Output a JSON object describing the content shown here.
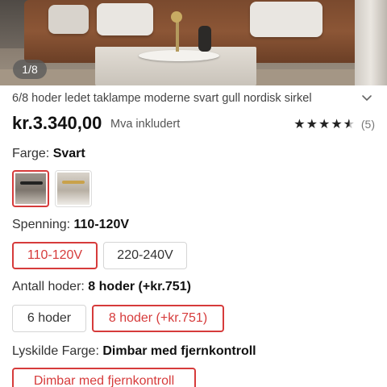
{
  "gallery": {
    "counter": "1/8"
  },
  "product": {
    "title": "6/8 hoder ledet taklampe moderne svart gull nordisk sirkel",
    "price": "kr.3.340,00",
    "vat_note": "Mva inkludert",
    "rating": 4.5,
    "stars": "★★★★★",
    "review_count": "(5)"
  },
  "options": {
    "color": {
      "label": "Farge:",
      "value": "Svart",
      "swatches": [
        {
          "name": "Svart",
          "selected": true
        },
        {
          "name": "Gull",
          "selected": false
        }
      ]
    },
    "voltage": {
      "label": "Spenning:",
      "value": "110-120V",
      "choices": [
        {
          "label": "110-120V",
          "selected": true
        },
        {
          "label": "220-240V",
          "selected": false
        }
      ]
    },
    "heads": {
      "label": "Antall hoder:",
      "value": "8 hoder (+kr.751)",
      "choices": [
        {
          "label": "6 hoder",
          "selected": false
        },
        {
          "label": "8 hoder (+kr.751)",
          "selected": true
        }
      ]
    },
    "light_color": {
      "label": "Lyskilde Farge:",
      "value": "Dimbar med fjernkontroll",
      "choices": [
        {
          "label": "Dimbar med fjernkontroll",
          "selected": true
        }
      ]
    }
  },
  "colors": {
    "accent": "#d63b3b",
    "text": "#222222",
    "muted": "#777777"
  }
}
